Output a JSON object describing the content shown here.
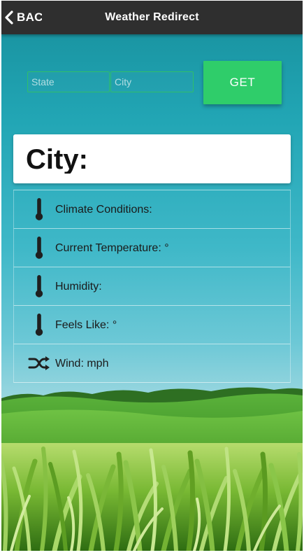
{
  "header": {
    "back_label": "BAC",
    "title": "Weather Redirect"
  },
  "form": {
    "state_placeholder": "State",
    "city_placeholder": "City",
    "get_label": "GET"
  },
  "city_card": {
    "label": "City:"
  },
  "weather_rows": [
    {
      "icon": "thermometer-icon",
      "label": "Climate Conditions:"
    },
    {
      "icon": "thermometer-icon",
      "label": "Current Temperature: °"
    },
    {
      "icon": "thermometer-icon",
      "label": "Humidity:"
    },
    {
      "icon": "thermometer-icon",
      "label": "Feels Like: °"
    },
    {
      "icon": "shuffle-icon",
      "label": "Wind: mph"
    }
  ],
  "colors": {
    "header_bg": "#2f2f2f",
    "accent_green": "#2fcd6a",
    "sky_teal": "#22a6b5"
  }
}
